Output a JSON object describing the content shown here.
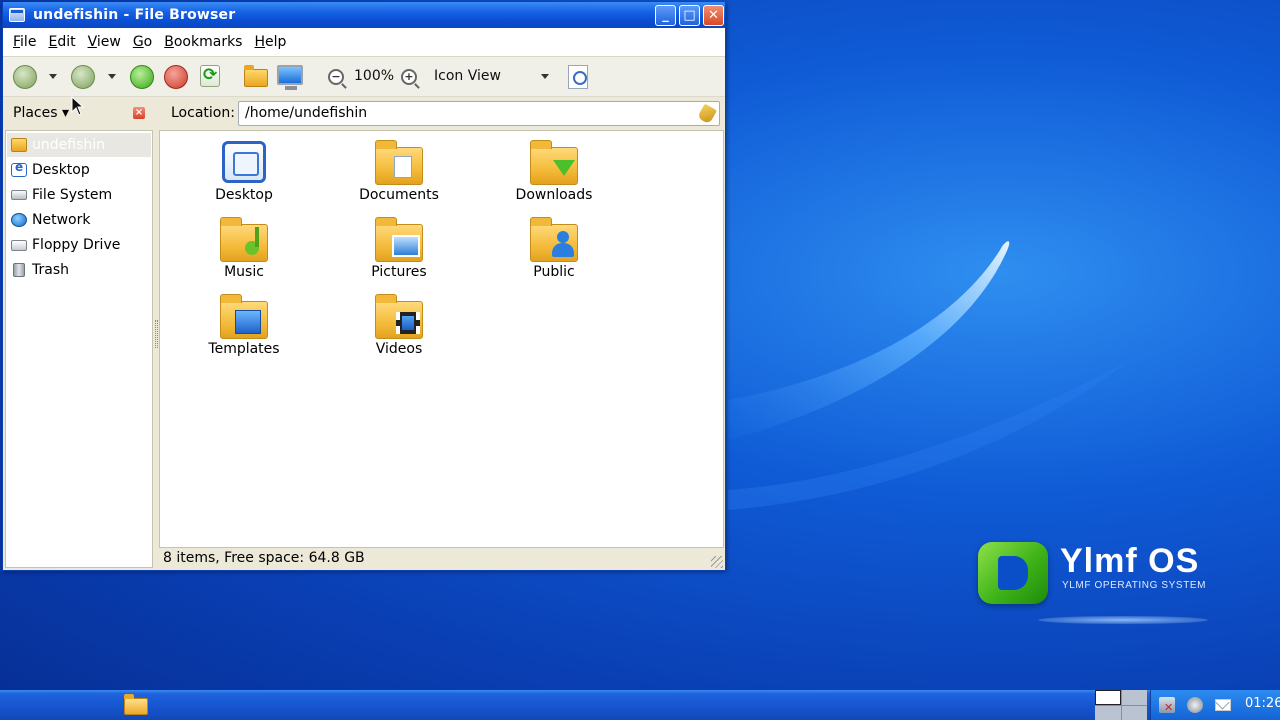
{
  "window": {
    "title": "undefishin - File Browser",
    "controls": {
      "minimize": "_",
      "maximize": "□",
      "close": "✕"
    }
  },
  "menubar": {
    "items": [
      {
        "label": "File",
        "mnemonic": "F"
      },
      {
        "label": "Edit",
        "mnemonic": "E"
      },
      {
        "label": "View",
        "mnemonic": "V"
      },
      {
        "label": "Go",
        "mnemonic": "G"
      },
      {
        "label": "Bookmarks",
        "mnemonic": "B"
      },
      {
        "label": "Help",
        "mnemonic": "H"
      }
    ]
  },
  "toolbar": {
    "zoom_level": "100%",
    "view_mode": "Icon View"
  },
  "places": {
    "label": "Places",
    "items": [
      {
        "label": "undefishin",
        "icon": "home-folder-icon",
        "selected": true
      },
      {
        "label": "Desktop",
        "icon": "desktop-icon"
      },
      {
        "label": "File System",
        "icon": "drive-icon"
      },
      {
        "label": "Network",
        "icon": "network-icon"
      },
      {
        "label": "Floppy Drive",
        "icon": "floppy-icon"
      },
      {
        "label": "Trash",
        "icon": "trash-icon"
      }
    ]
  },
  "location": {
    "label": "Location:",
    "value": "/home/undefishin"
  },
  "files": [
    {
      "name": "Desktop",
      "icon": "desktop-icon"
    },
    {
      "name": "Documents",
      "icon": "folder-documents-icon"
    },
    {
      "name": "Downloads",
      "icon": "folder-downloads-icon"
    },
    {
      "name": "Music",
      "icon": "folder-music-icon"
    },
    {
      "name": "Pictures",
      "icon": "folder-pictures-icon"
    },
    {
      "name": "Public",
      "icon": "folder-public-icon"
    },
    {
      "name": "Templates",
      "icon": "folder-templates-icon"
    },
    {
      "name": "Videos",
      "icon": "folder-videos-icon"
    }
  ],
  "statusbar": {
    "text": "8 items, Free space: 64.8 GB"
  },
  "desktop": {
    "brand_name": "Ylmf OS",
    "brand_subtitle": "YLMF OPERATING SYSTEM"
  },
  "taskbar": {
    "clock": "01:26"
  },
  "colors": {
    "titlebar": "#1560e3",
    "desktop_bg": "#0f5bd6",
    "window_bg": "#ece9d8",
    "brand_green": "#3eb318"
  }
}
